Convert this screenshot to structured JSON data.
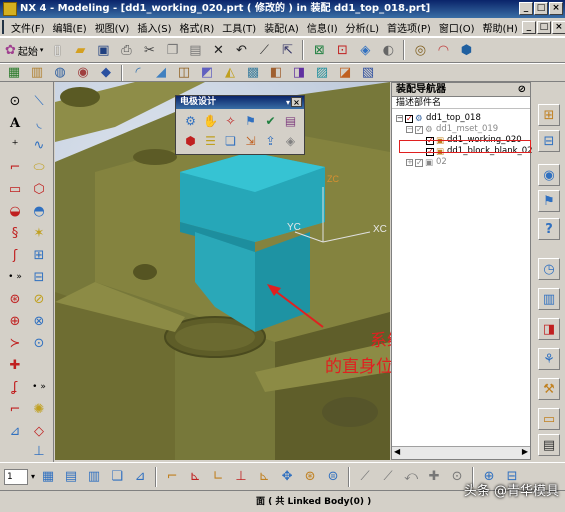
{
  "window": {
    "title": "NX 4 - Modeling - [dd1_working_020.prt ( 修改的 ) in 装配 dd1_top_018.prt]",
    "controls": [
      "_",
      "□",
      "×"
    ]
  },
  "menubar": {
    "items": [
      "文件(F)",
      "编辑(E)",
      "视图(V)",
      "插入(S)",
      "格式(R)",
      "工具(T)",
      "装配(A)",
      "信息(I)",
      "分析(L)",
      "首选项(P)",
      "窗口(O)",
      "帮助(H)"
    ],
    "controls": [
      "_",
      "□",
      "×"
    ]
  },
  "toolbar1": {
    "start_label": "起始"
  },
  "dialog": {
    "title": "电极设计",
    "close": "×"
  },
  "navigator": {
    "title": "装配导航器",
    "column_header": "描述部件名",
    "tree": [
      {
        "label": "dd1_top_018",
        "level": 0,
        "checked": true
      },
      {
        "label": "dd1_mset_019",
        "level": 1,
        "checked": true,
        "gray": true
      },
      {
        "label": "dd1_working_020",
        "level": 2,
        "checked": true
      },
      {
        "label": "dd1_block_blank_023",
        "level": 2,
        "checked": true
      },
      {
        "label": "02",
        "level": 1,
        "checked": true,
        "gray": true
      }
    ]
  },
  "viewport": {
    "axis_labels": [
      "YC",
      "XC"
    ],
    "annotation_line1": "系统自动生成",
    "annotation_line2": "的直身位."
  },
  "bottombar": {
    "layer_value": "1"
  },
  "statusbar": {
    "text": "面 ( 共 Linked Body(0) )"
  },
  "watermark": "头条 @青华模具",
  "colors": {
    "part_olive": "#7b7a3a",
    "electrode_cyan": "#2bb5c6",
    "annotation_red": "#e02020"
  }
}
